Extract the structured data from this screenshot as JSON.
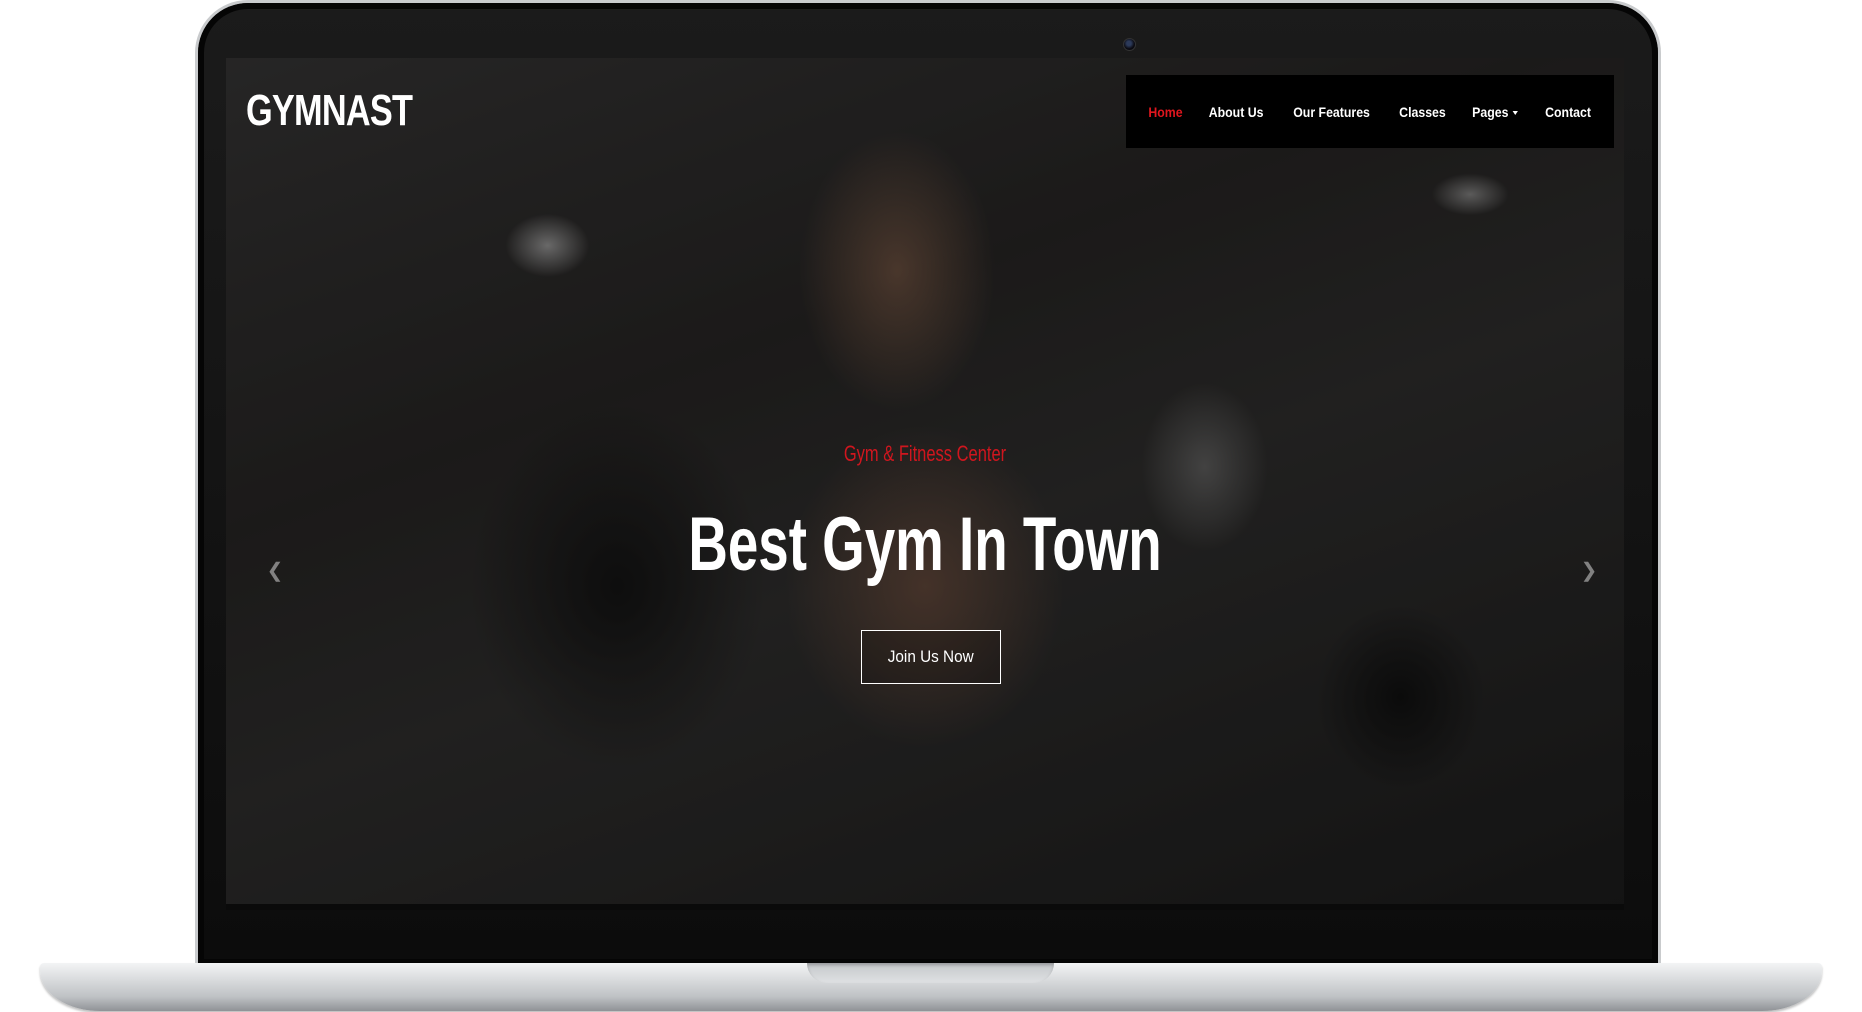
{
  "brand": {
    "logo_text": "GYMNAST"
  },
  "nav": {
    "items": [
      {
        "label": "Home",
        "active": true
      },
      {
        "label": "About Us",
        "active": false
      },
      {
        "label": "Our Features",
        "active": false
      },
      {
        "label": "Classes",
        "active": false
      },
      {
        "label": "Pages",
        "active": false,
        "has_dropdown": true
      },
      {
        "label": "Contact",
        "active": false
      }
    ]
  },
  "hero": {
    "subtitle": "Gym & Fitness Center",
    "title": "Best Gym In Town",
    "cta_label": "Join Us Now",
    "prev_icon": "arrow-left-icon",
    "next_icon": "arrow-right-icon"
  },
  "colors": {
    "accent": "#e0161e",
    "nav_bg": "#000000",
    "text": "#ffffff"
  }
}
